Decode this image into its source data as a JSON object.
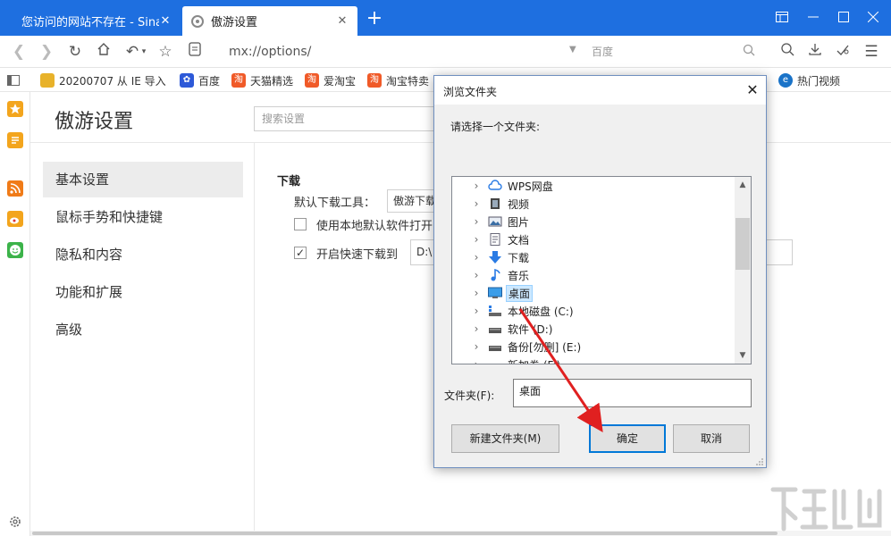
{
  "tabs": [
    {
      "label": "您访问的网站不存在 - Sina A",
      "active": false
    },
    {
      "label": "傲游设置",
      "active": true
    }
  ],
  "toolbar": {
    "address": "mx://options/",
    "search_placeholder": "百度"
  },
  "bookmarks": [
    {
      "label": "20200707 从 IE 导入",
      "icon": "folder-icon",
      "color": "#e8b22a"
    },
    {
      "label": "百度",
      "icon": "paw-icon",
      "color": "#2d59d8"
    },
    {
      "label": "天猫精选",
      "icon": "tao-icon",
      "color": "#f05a28"
    },
    {
      "label": "爱淘宝",
      "icon": "tao-icon",
      "color": "#f05a28"
    },
    {
      "label": "淘宝特卖",
      "icon": "tao-icon",
      "color": "#f05a28"
    },
    {
      "label": "热门视频",
      "icon": "ie-icon",
      "color": "#1a73c8"
    }
  ],
  "settings": {
    "title": "傲游设置",
    "search_placeholder": "搜索设置",
    "menu": [
      "基本设置",
      "鼠标手势和快捷键",
      "隐私和内容",
      "功能和扩展",
      "高级"
    ],
    "selected_menu": 0,
    "download": {
      "section": "下载",
      "tool_label": "默认下载工具：",
      "tool_value": "傲游下载",
      "use_local_label": "使用本地默认软件打开",
      "use_local_checked": false,
      "quick_label": "开启快速下载到",
      "quick_checked": true,
      "path_value": "D:\\"
    }
  },
  "dialog": {
    "title": "浏览文件夹",
    "prompt": "请选择一个文件夹:",
    "tree": [
      {
        "label": "WPS网盘",
        "icon": "cloud-icon"
      },
      {
        "label": "视频",
        "icon": "video-icon"
      },
      {
        "label": "图片",
        "icon": "picture-icon"
      },
      {
        "label": "文档",
        "icon": "document-icon"
      },
      {
        "label": "下载",
        "icon": "download-arrow-icon"
      },
      {
        "label": "音乐",
        "icon": "music-note-icon"
      },
      {
        "label": "桌面",
        "icon": "desktop-icon",
        "selected": true
      },
      {
        "label": "本地磁盘 (C:)",
        "icon": "system-drive-icon"
      },
      {
        "label": "软件 (D:)",
        "icon": "drive-icon"
      },
      {
        "label": "备份[勿删] (E:)",
        "icon": "drive-icon"
      },
      {
        "label": "新加卷 (F:)",
        "icon": "drive-icon"
      }
    ],
    "folder_label": "文件夹(F):",
    "folder_value": "桌面",
    "new_folder_button": "新建文件夹(M)",
    "ok_button": "确定",
    "cancel_button": "取消"
  },
  "colors": {
    "titlebar": "#1e6fe0",
    "annotation_arrow": "#e02020",
    "selection": "#cce8ff"
  }
}
